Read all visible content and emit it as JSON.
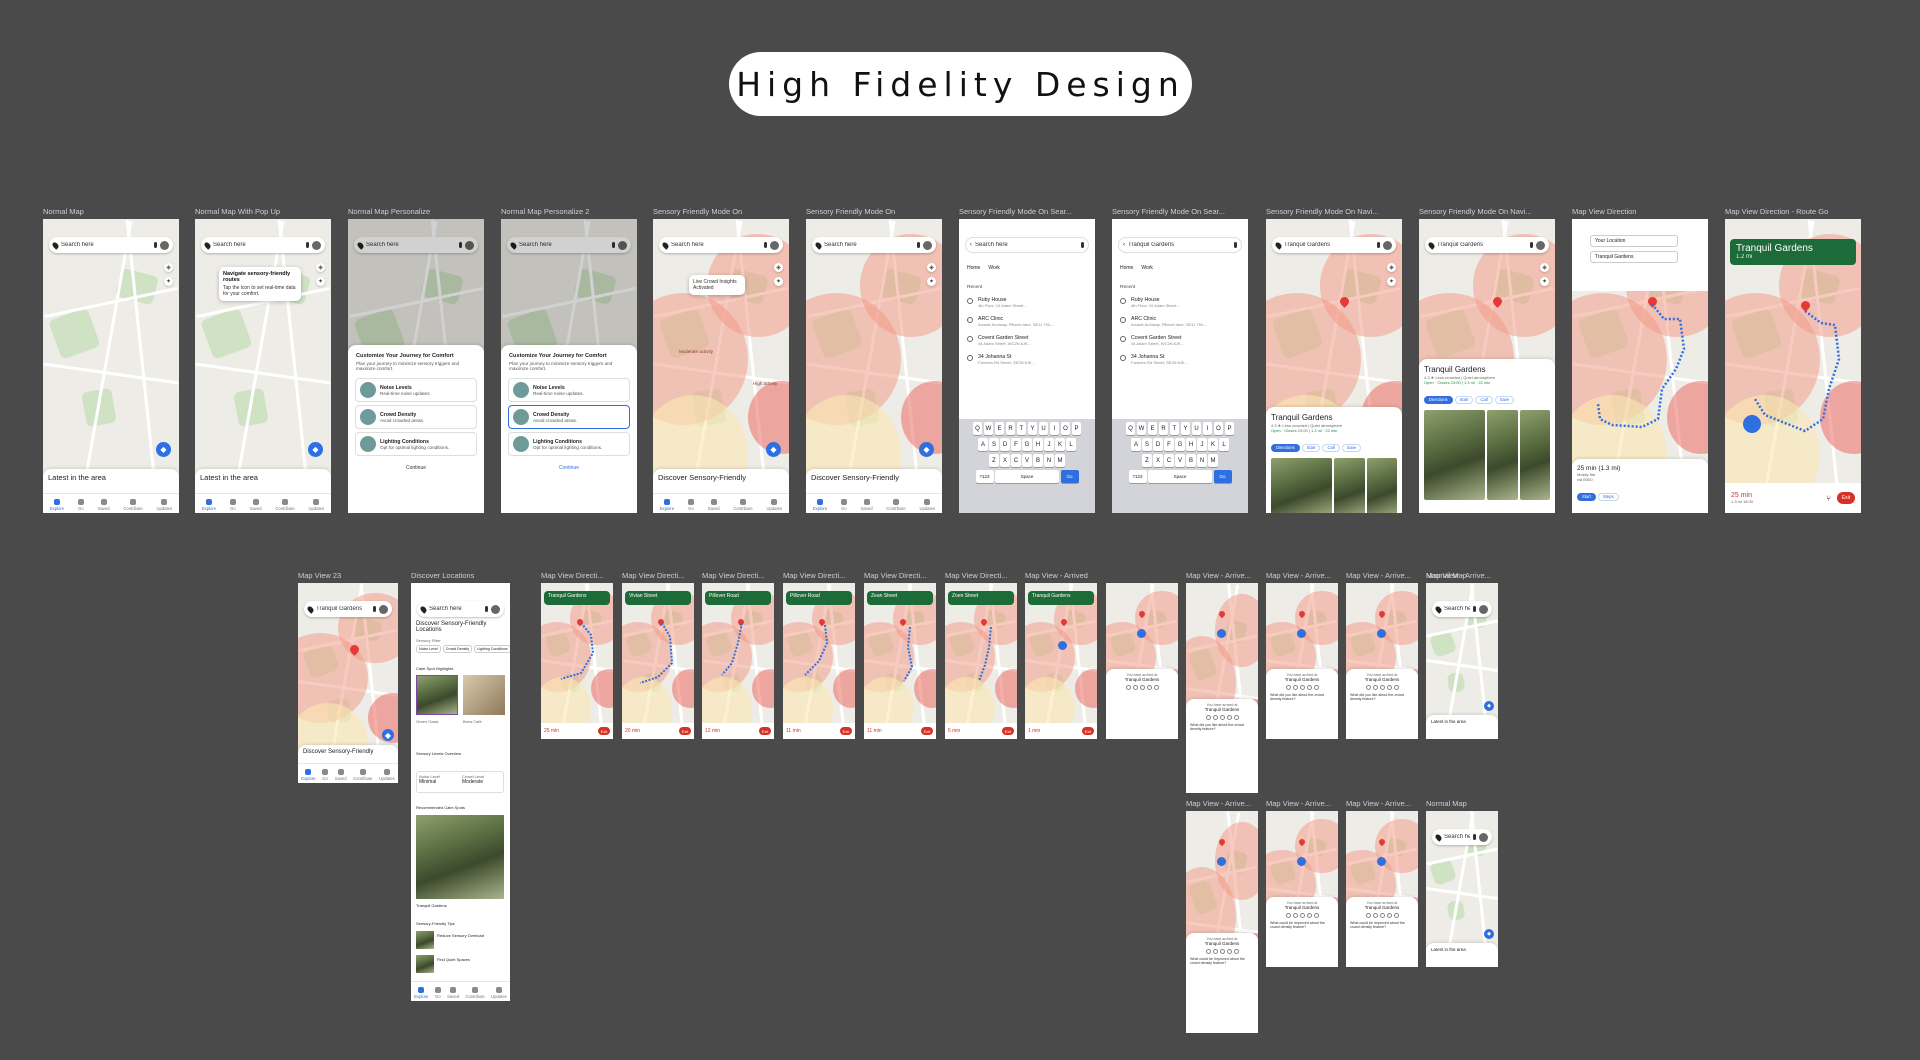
{
  "title": "High Fidelity Design",
  "row1": [
    {
      "label": "Normal Map"
    },
    {
      "label": "Normal Map With Pop Up"
    },
    {
      "label": "Normal Map Personalize"
    },
    {
      "label": "Normal Map Personalize 2"
    },
    {
      "label": "Sensory Friendly Mode On"
    },
    {
      "label": "Sensory Friendly Mode On"
    },
    {
      "label": "Sensory Friendly Mode On Sear..."
    },
    {
      "label": "Sensory Friendly Mode On Sear..."
    },
    {
      "label": "Sensory Friendly Mode On Navi..."
    },
    {
      "label": "Sensory Friendly Mode On Navi..."
    },
    {
      "label": "Map View Direction"
    },
    {
      "label": "Map View Direction - Route Go"
    }
  ],
  "row2": [
    {
      "label": "Map View 23"
    },
    {
      "label": "Discover Locations"
    },
    {
      "label": "Map View Directi..."
    },
    {
      "label": "Map View Directi..."
    },
    {
      "label": "Map View Directi..."
    },
    {
      "label": "Map View Directi..."
    },
    {
      "label": "Map View Directi..."
    },
    {
      "label": "Map View Directi..."
    },
    {
      "label": "Map View - Arrived"
    },
    {
      "label": "Map View - Arrive..."
    },
    {
      "label": "Map View - Arrive..."
    },
    {
      "label": "Map View - Arrive..."
    },
    {
      "label": "Map View - Arrive..."
    },
    {
      "label": "Normal Map"
    }
  ],
  "row3": [
    {
      "label": "Map View - Arrive..."
    },
    {
      "label": "Map View - Arrive..."
    },
    {
      "label": "Map View - Arrive..."
    },
    {
      "label": "Normal Map"
    }
  ],
  "common": {
    "search_placeholder": "Search here",
    "latest": "Latest in the area",
    "discover": "Discover Sensory-Friendly",
    "nav": [
      "Explore",
      "Go",
      "Saved",
      "Contribute",
      "Updates"
    ]
  },
  "popup": {
    "title": "Navigate sensory-friendly routes",
    "body": "Tap the icon to set real-time data for your comfort."
  },
  "personalize": {
    "title": "Customize Your Journey for Comfort",
    "subtitle": "Plan your journey to minimize sensory triggers and maximize comfort.",
    "options": [
      {
        "title": "Noise Levels",
        "desc": "Real-time noise updates."
      },
      {
        "title": "Crowd Density",
        "desc": "Avoid crowded areas."
      },
      {
        "title": "Lighting Conditions",
        "desc": "Opt for optimal lighting conditions."
      }
    ],
    "continue": "Continue"
  },
  "sensory": {
    "insights": "Live Crowd Insights Activated",
    "moderate": "Moderate activity",
    "high": "High activity"
  },
  "search_screen": {
    "value": "Tranquil Gardens",
    "home": "Home",
    "work": "Work",
    "recent": "Recent",
    "items": [
      {
        "name": "Ruby House",
        "addr": "4th Floor, 10 Adam Street..."
      },
      {
        "name": "ARC Clinic",
        "addr": "Arcade Archway, Pillover lane, SE11 7HL..."
      },
      {
        "name": "Covent Garden Street",
        "addr": "44 Adam Street, WC2N 6JK..."
      },
      {
        "name": "34 Johanna St",
        "addr": "Farmers Rd Street, SE2N 6JK..."
      }
    ],
    "keys_row1": [
      "Q",
      "W",
      "E",
      "R",
      "T",
      "Y",
      "U",
      "I",
      "O",
      "P"
    ],
    "keys_row2": [
      "A",
      "S",
      "D",
      "F",
      "G",
      "H",
      "J",
      "K",
      "L"
    ],
    "keys_row3": [
      "Z",
      "X",
      "C",
      "V",
      "B",
      "N",
      "M"
    ],
    "num": "?123",
    "space": "Space",
    "go": "Go"
  },
  "place": {
    "name": "Tranquil Gardens",
    "rating": "4.3 ★ Less crowded | Quiet atmosphere",
    "open": "Open · Closes 23:00 | 1.3 mi · 22 min",
    "directions": "Directions",
    "start": "Start",
    "call": "Call",
    "save": "Save"
  },
  "direction": {
    "from": "Your Location",
    "to": "Tranquil Gardens",
    "time": "25 min (1.3 mi)",
    "note": "Mostly flat",
    "via": "via B300",
    "start": "Start",
    "steps": "Steps"
  },
  "route_go": {
    "dest": "Tranquil Gardens",
    "dist": "1.2 mi",
    "eta": "25 min",
    "sub": "1.3 mi 18:00",
    "exit": "Exit"
  },
  "mini_nav": [
    {
      "street": "Tranquil Gardens",
      "eta": "25 min"
    },
    {
      "street": "Vivian Street",
      "eta": "20 min"
    },
    {
      "street": "Pillover Road",
      "eta": "12 min"
    },
    {
      "street": "Pillover Road",
      "eta": "11 min"
    },
    {
      "street": "Zean Street",
      "eta": "11 min"
    },
    {
      "street": "Zoen Street",
      "eta": "5 min"
    },
    {
      "street": "Tranquil Gardens",
      "eta": "1 min"
    }
  ],
  "arrived": {
    "heading": "You have arrived at",
    "place": "Tranquil Gardens",
    "question": "What did you like about the crowd density feature?",
    "question2": "What could be improved about the crowd density feature?"
  },
  "discover_screen": {
    "title": "Discover Sensory-Friendly Locations",
    "filter": "Sensory Filter",
    "chips": [
      "Noise Level",
      "Crowd Density",
      "Lighting Conditions"
    ],
    "highlights": "Calm Spot Highlights",
    "overview": "Sensory Levels Overview",
    "noise": "Noise Level",
    "noise_val": "Minimal",
    "crowd": "Crowd Level",
    "crowd_val": "Moderate",
    "recommended": "Recommended Calm Spots",
    "place": "Tranquil Gardens",
    "tips": "Sensory-Friendly Tips",
    "tip1": "Reduce Sensory Overload",
    "tip2": "Find Quiet Spaces",
    "spot1": "Green Oasis",
    "spot2": "Brew Café"
  }
}
